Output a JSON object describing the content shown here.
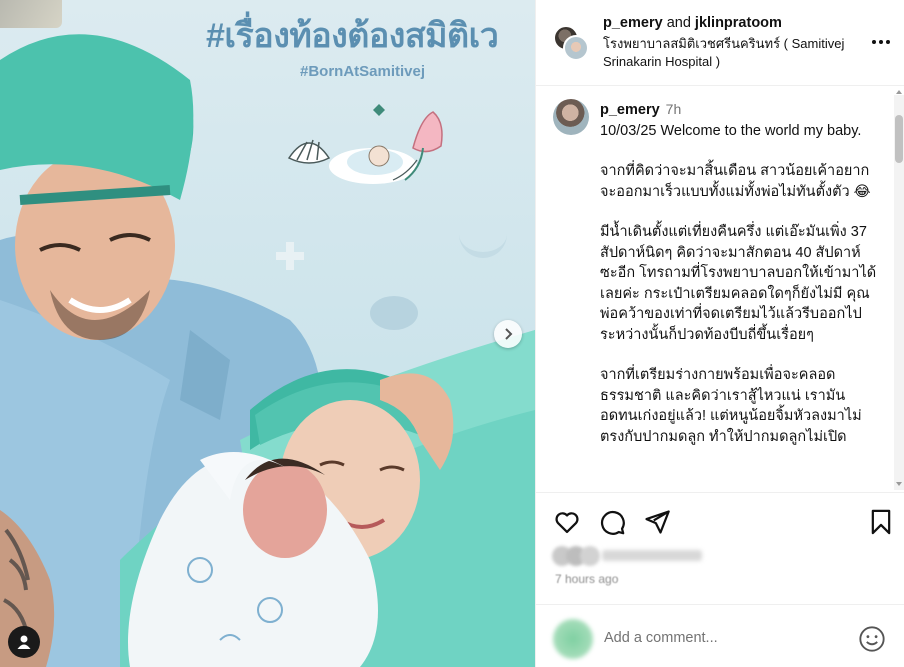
{
  "media": {
    "wall_heading": "#เรื่องท้องต้องสมิติเว",
    "wall_hashtag": "#BornAtSamitivej",
    "next_icon": "chevron-right-icon",
    "tag_icon": "user-tag-icon"
  },
  "header": {
    "user1": "p_emery",
    "joiner": "and",
    "user2": "jklinpratoom",
    "location": "โรงพยาบาลสมิติเวชศรีนครินทร์ ( Samitivej Srinakarin Hospital )",
    "more_icon": "more-horizontal-icon"
  },
  "caption": {
    "username": "p_emery",
    "time": "7h",
    "paragraphs": [
      "10/03/25 Welcome to the world my baby.",
      "จากที่คิดว่าจะมาสิ้นเดือน สาวน้อยเค้าอยากจะออกมาเร็วแบบทั้งแม่ทั้งพ่อไม่ทันตั้งตัว 😂",
      "มีน้ำเดินตั้งแต่เที่ยงคืนครึ่ง แต่เอ๊ะมันเพิ่ง 37 สัปดาห์นิดๆ คิดว่าจะมาสักตอน 40 สัปดาห์ ซะอีก โทรถามที่โรงพยาบาลบอกให้เข้ามาได้เลยค่ะ กระเป๋าเตรียมคลอดใดๆก็ยังไม่มี คุณพ่อคว้าของเท่าที่จดเตรียมไว้แล้วรีบออกไป ระหว่างนั้นก็ปวดท้องบีบถี่ขึ้นเรื่อยๆ",
      "จากที่เตรียมร่างกายพร้อมเพื่อจะคลอดธรรมชาติ และคิดว่าเราสู้ไหวแน่ เรามันอดทนเก่งอยู่แล้ว! แต่หนูน้อยจิ้มหัวลงมาไม่ตรงกับปากมดลูก ทำให้ปากมดลูกไม่เปิด"
    ]
  },
  "actions": {
    "like_icon": "heart-icon",
    "comment_icon": "comment-icon",
    "share_icon": "send-icon",
    "save_icon": "bookmark-icon"
  },
  "meta": {
    "ago": "7 hours ago"
  },
  "comment": {
    "placeholder": "Add a comment...",
    "emoji_icon": "emoji-icon"
  }
}
